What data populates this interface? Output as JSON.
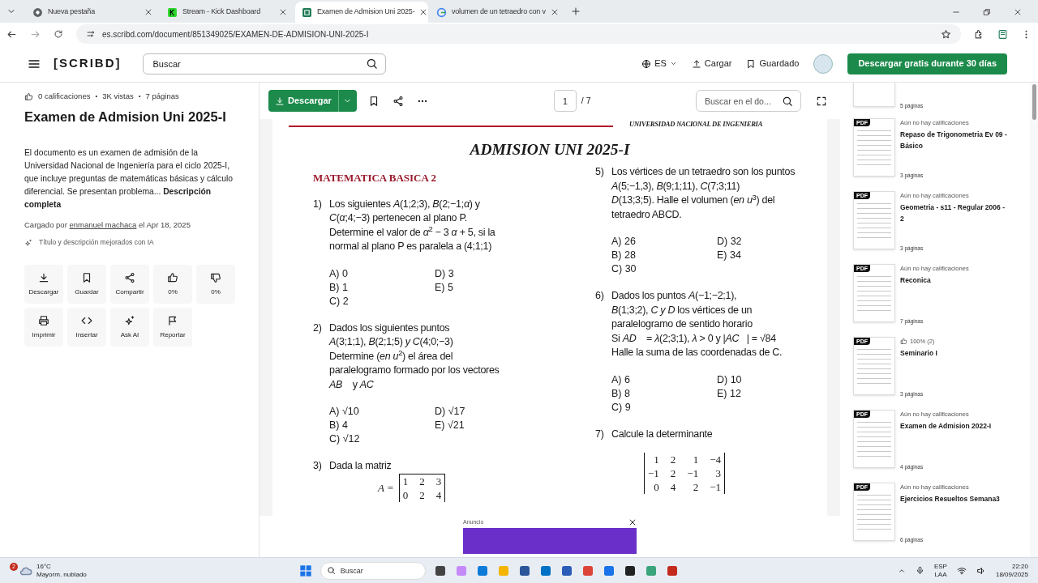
{
  "browser": {
    "tabs": [
      {
        "title": "Nueva pestaña",
        "selected": false,
        "kind": "chrome"
      },
      {
        "title": "Stream - Kick Dashboard",
        "selected": false,
        "kind": "kick"
      },
      {
        "title": "Examen de Admision Uni 2025-",
        "selected": true,
        "kind": "scribd"
      },
      {
        "title": "volumen de un tetraedro con v",
        "selected": false,
        "kind": "google"
      }
    ],
    "url": "es.scribd.com/document/851349025/EXAMEN-DE-ADMISION-UNI-2025-I"
  },
  "header": {
    "logo": "[SCRIBD]",
    "search_placeholder": "Buscar",
    "language": "ES",
    "upload": "Cargar",
    "saved": "Guardado",
    "cta": "Descargar gratis durante 30 días"
  },
  "details": {
    "meta_separator": "•",
    "meta": [
      "0 calificaciones",
      "3K vistas",
      "7 páginas"
    ],
    "title": "Examen de Admision Uni 2025-I",
    "description": "El documento es un examen de admisión de la Universidad Nacional de Ingeniería para el ciclo 2025-I, que incluye preguntas de matemáticas básicas y cálculo diferencial. Se presentan problema... **Descripción completa**",
    "uploaded_prefix": "Cargado por",
    "uploader": "enmanuel machaca",
    "uploaded_suffix": "el Apr 18, 2025",
    "ai_note": "Título y descripción mejorados con IA",
    "actions": [
      {
        "label": "Descargar",
        "kind": "download"
      },
      {
        "label": "Guardar",
        "kind": "bookmark"
      },
      {
        "label": "Compartir",
        "kind": "share"
      },
      {
        "label": "0%",
        "kind": "like"
      },
      {
        "label": "0%",
        "kind": "dislike"
      },
      {
        "label": "Imprimir",
        "kind": "print"
      },
      {
        "label": "Insertar",
        "kind": "embed"
      },
      {
        "label": "Ask AI",
        "kind": "ai"
      },
      {
        "label": "Reportar",
        "kind": "flag"
      }
    ]
  },
  "viewer": {
    "download": "Descargar",
    "page": "1",
    "total": "/ 7",
    "search_placeholder": "Buscar en el do..."
  },
  "document": {
    "institution": "UNIVERSIDAD NACIONAL DE INGENIERIA",
    "title": "ADMISION UNI 2025-I",
    "section": "MATEMATICA BASICA 2",
    "left_column": [
      {
        "number": "1)",
        "lines": [
          "Los siguientes *A*(1;2;3), *B*(2;−1;*α*) y",
          "*C*(*α*;4;−3) pertenecen al plano P.",
          "Determine el valor de *α*$^{2}$ − 3 *α* + 5, si la",
          "normal al plano P es paralela a (4;1;1)"
        ],
        "options": [
          "A) 0",
          "B) 1",
          "C) 2",
          "D) 3",
          "E) 5"
        ]
      },
      {
        "number": "2)",
        "lines": [
          "Dados los siguientes puntos",
          "*A*(3;1;1), *B*(2;1;5) *y C*(4;0;−3)",
          "Determine (*en u*$^{2}$) el área del",
          "paralelogramo formado por los vectores",
          "*AB⃗* y *AC⃗*"
        ],
        "options": [
          "A) √10",
          "B) 4",
          "C) √12",
          "D) √17",
          "E) √21"
        ]
      },
      {
        "number": "3)",
        "lines": [
          "Dada la matriz"
        ],
        "matrix": {
          "kind": "matrix",
          "label": "A =",
          "rows": [
            [
              "1",
              "2",
              "3"
            ],
            [
              "0",
              "2",
              "4"
            ]
          ]
        }
      }
    ],
    "right_column": [
      {
        "number": "5)",
        "lines": [
          "Los vértices de un tetraedro son los puntos",
          "*A*(5;−1,3), *B*(9;1;11), *C*(7;3;11)",
          "*D*(13;3;5). Halle el volumen (*en u*$^{3}$) del",
          "tetraedro ABCD."
        ],
        "options": [
          "A) 26",
          "B) 28",
          "C) 30",
          "D) 32",
          "E) 34"
        ]
      },
      {
        "number": "6)",
        "lines": [
          "Dados los puntos *A*(−1;−2;1),",
          "*B*(1;3;2), *C y D* los vértices de un",
          "paralelogramo de sentido horario",
          "Si *AD⃗* = *λ*(2;3;1), *λ* > 0 y |*AC⃗*| = √84",
          "Halle la suma de las coordenadas de C."
        ],
        "options": [
          "A) 6",
          "B) 8",
          "C) 9",
          "D) 10",
          "E) 12"
        ]
      },
      {
        "number": "7)",
        "lines": [
          "Calcule la determinante"
        ],
        "matrix": {
          "kind": "determinant",
          "rows": [
            [
              "1",
              "2",
              "1",
              "−4"
            ],
            [
              "−1",
              "2",
              "−1",
              "3"
            ],
            [
              "0",
              "4",
              "2",
              "−1"
            ]
          ]
        }
      }
    ]
  },
  "ad": {
    "label": "Anuncio"
  },
  "related": [
    {
      "kind": "partial",
      "pages": "5 páginas"
    },
    {
      "kind": "unrated",
      "badge": "PDF",
      "rating": "Aún no hay calificaciones",
      "title": "Repaso de Trigonometria Ev 09 - Básico",
      "pages": "3 páginas"
    },
    {
      "kind": "unrated",
      "badge": "PDF",
      "rating": "Aún no hay calificaciones",
      "title": "Geometria - s11 - Regular 2006 - 2",
      "pages": "3 páginas"
    },
    {
      "kind": "unrated",
      "badge": "PDF",
      "rating": "Aún no hay calificaciones",
      "title": "Reconica",
      "pages": "7 páginas"
    },
    {
      "kind": "rated",
      "badge": "PDF",
      "rating": "100% (2)",
      "title": "Seminario I",
      "pages": "3 páginas"
    },
    {
      "kind": "unrated",
      "badge": "PDF",
      "rating": "Aún no hay calificaciones",
      "title": "Examen de Admision 2022-I",
      "pages": "4 páginas"
    },
    {
      "kind": "unrated",
      "badge": "PDF",
      "rating": "Aún no hay calificaciones",
      "title": "Ejercicios Resueltos Semana3",
      "pages": "6 páginas"
    }
  ],
  "taskbar": {
    "weather_badge": "2",
    "temperature": "16°C",
    "condition": "Mayorm. nublado",
    "search_placeholder": "Buscar",
    "language": "ESP",
    "layout": "LAA",
    "time": "22:20",
    "date": "18/09/2025"
  }
}
